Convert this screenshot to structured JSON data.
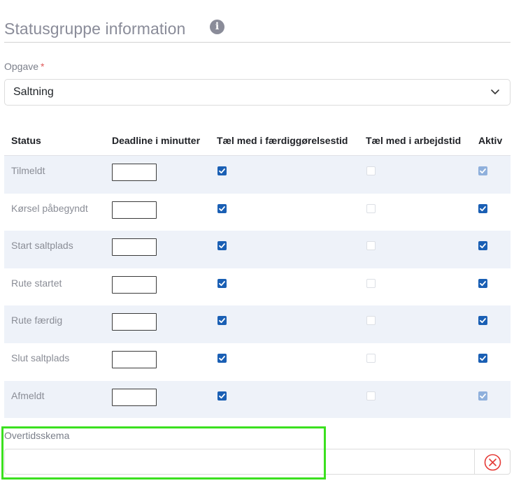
{
  "header": {
    "title": "Statusgruppe information",
    "info_icon": "info-icon"
  },
  "opgave": {
    "label": "Opgave",
    "required_mark": "*",
    "selected": "Saltning"
  },
  "table": {
    "headers": {
      "status": "Status",
      "deadline": "Deadline i minutter",
      "completion": "Tæl med i færdiggørelsestid",
      "worktime": "Tæl med i arbejdstid",
      "active": "Aktiv"
    },
    "rows": [
      {
        "status": "Tilmeldt",
        "deadline": "",
        "completion": "checked",
        "worktime": "unchecked-disabled",
        "active": "checked-disabled"
      },
      {
        "status": "Kørsel påbegyndt",
        "deadline": "",
        "completion": "checked",
        "worktime": "unchecked-disabled",
        "active": "checked"
      },
      {
        "status": "Start saltplads",
        "deadline": "",
        "completion": "checked",
        "worktime": "unchecked-disabled",
        "active": "checked"
      },
      {
        "status": "Rute startet",
        "deadline": "",
        "completion": "checked",
        "worktime": "unchecked-disabled",
        "active": "checked"
      },
      {
        "status": "Rute færdig",
        "deadline": "",
        "completion": "checked",
        "worktime": "unchecked-disabled",
        "active": "checked"
      },
      {
        "status": "Slut saltplads",
        "deadline": "",
        "completion": "checked",
        "worktime": "unchecked-disabled",
        "active": "checked"
      },
      {
        "status": "Afmeldt",
        "deadline": "",
        "completion": "checked",
        "worktime": "unchecked-disabled",
        "active": "checked-disabled"
      }
    ]
  },
  "overtid": {
    "label": "Overtidsskema",
    "value": "",
    "clear_icon": "close-circle-icon"
  },
  "colors": {
    "accent": "#1a5fb4",
    "highlight": "#3be01f",
    "clear": "#e53935",
    "row_stripe": "#eef2f9"
  }
}
